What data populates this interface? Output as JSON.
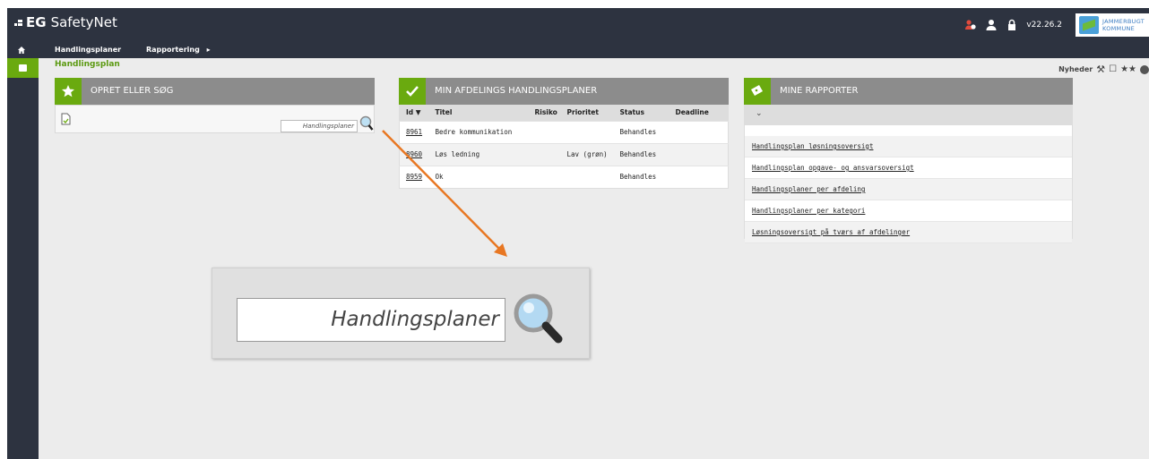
{
  "app": {
    "brand_mark": "EG",
    "brand_name": "SafetyNet",
    "version": "v22.26.2",
    "kommune_name_1": "JAMMERBUGT",
    "kommune_name_2": "KOMMUNE"
  },
  "nav": {
    "items": [
      {
        "label": "Handlingsplaner"
      },
      {
        "label": "Rapportering"
      }
    ]
  },
  "breadcrumb": "Handlingsplan",
  "toplinks": {
    "news": "Nyheder"
  },
  "panel_create": {
    "title": "OPRET ELLER SØG",
    "search_placeholder": "Handlingsplaner"
  },
  "panel_dept": {
    "title": "MIN AFDELINGS HANDLINGSPLANER",
    "columns": [
      "Id ▼",
      "Titel",
      "Risiko",
      "Prioritet",
      "Status",
      "Deadline"
    ],
    "rows": [
      {
        "id": "8961",
        "title": "Bedre kommunikation",
        "risk": "",
        "priority": "",
        "status": "Behandles",
        "deadline": ""
      },
      {
        "id": "8960",
        "title": "Løs ledning",
        "risk": "",
        "priority": "Lav (grøn)",
        "status": "Behandles",
        "deadline": ""
      },
      {
        "id": "8959",
        "title": "Ok",
        "risk": "",
        "priority": "",
        "status": "Behandles",
        "deadline": ""
      }
    ]
  },
  "panel_reports": {
    "title": "MINE RAPPORTER",
    "items": [
      "Handlingsplan løsningsoversigt",
      "Handlingsplan opgave- og ansvarsoversigt",
      "Handlingsplaner per afdeling",
      "Handlingsplaner per kategori",
      "Løsningsoversigt på tværs af afdelinger"
    ]
  },
  "zoom_callout": {
    "field_text": "Handlingsplaner",
    "arrow_color": "#e87722"
  },
  "colors": {
    "dark": "#2d3340",
    "accent": "#6aaa0f",
    "panel_head": "#8c8c8c"
  }
}
